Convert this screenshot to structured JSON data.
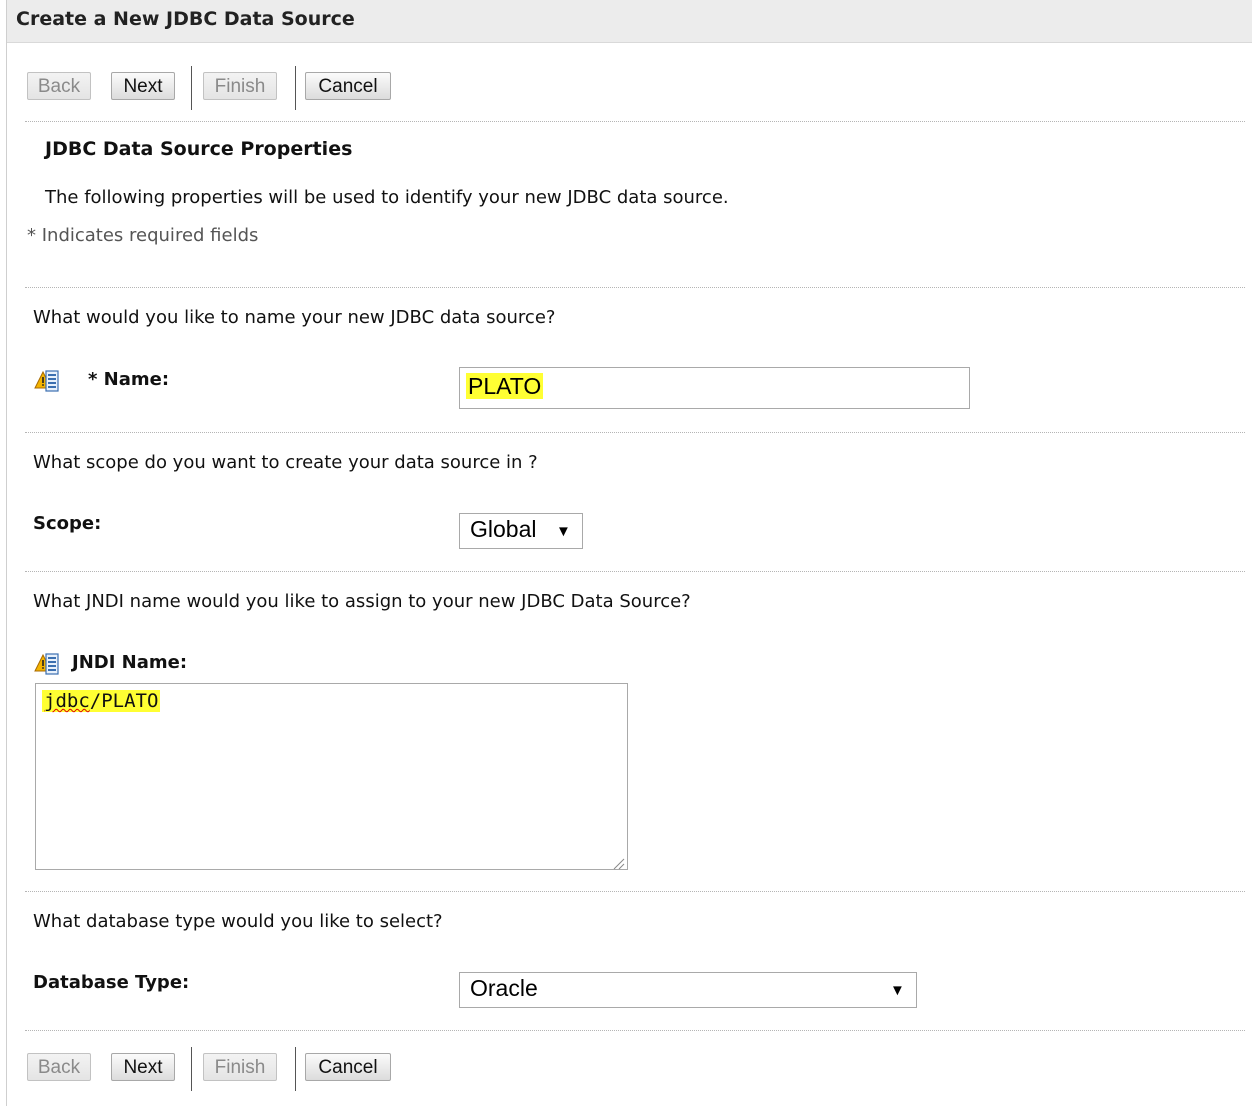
{
  "window": {
    "title": "Create a New JDBC Data Source"
  },
  "buttons": {
    "back": "Back",
    "next": "Next",
    "finish": "Finish",
    "cancel": "Cancel"
  },
  "section": {
    "title": "JDBC Data Source Properties",
    "intro": "The following properties will be used to identify your new JDBC data source.",
    "required_note": "* Indicates required fields"
  },
  "name_field": {
    "question": "What would you like to name your new JDBC data source?",
    "label": "* Name:",
    "value": "PLATO",
    "highlight_color": "#ffff33"
  },
  "scope_field": {
    "question": "What scope do you want to create your data source in ?",
    "label": "Scope:",
    "selected": "Global"
  },
  "jndi_field": {
    "question": "What JNDI name would you like to assign to your new JDBC Data Source?",
    "label": "JNDI Name:",
    "value_part1": "jdbc",
    "value_part2": "/PLATO"
  },
  "db_type_field": {
    "question": "What database type would you like to select?",
    "label": "Database Type:",
    "selected": "Oracle"
  },
  "icons": {
    "field_info": "info-warning-icon",
    "dropdown": "chevron-down-icon"
  }
}
